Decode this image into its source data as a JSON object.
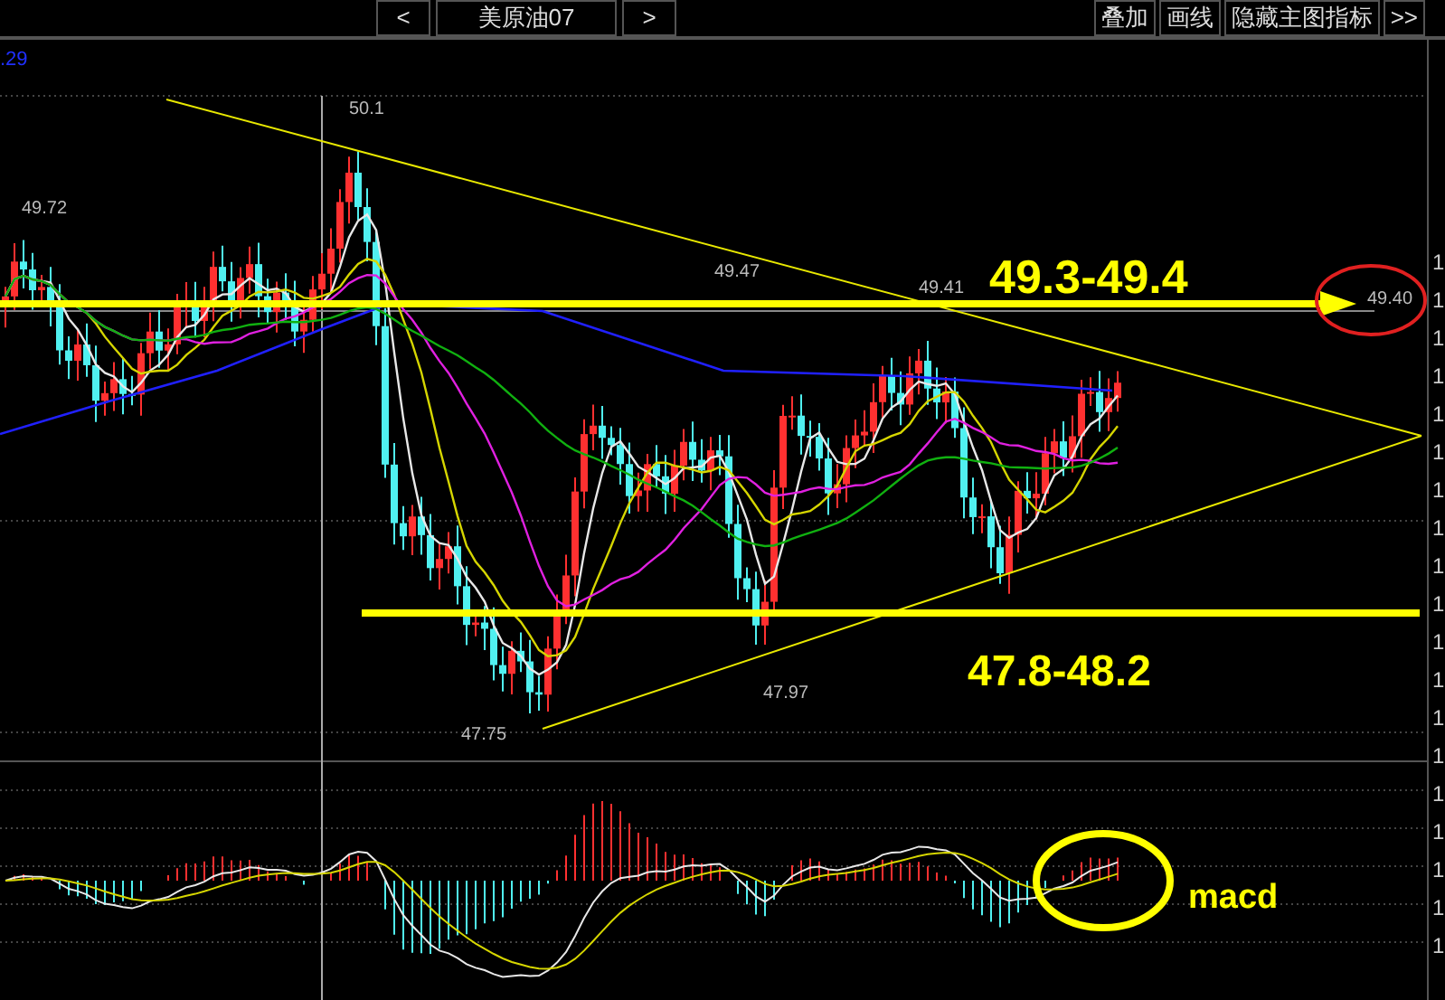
{
  "toolbar": {
    "prev_button": "<",
    "symbol": "美原油07",
    "next_button": ">",
    "buttons": [
      "叠加",
      "画线",
      "隐藏主图指标",
      ">>"
    ]
  },
  "chart": {
    "corner_value": ".29",
    "price_labels": [
      "50.1",
      "49.72",
      "49.47",
      "49.41",
      "47.97",
      "47.75"
    ],
    "current_price": "49.40",
    "annotations": [
      "49.3-49.4",
      "47.8-48.2"
    ]
  },
  "macd_panel": {
    "label": "macd"
  },
  "right_axis_labels": [
    "1",
    "1",
    "1",
    "1",
    "1",
    "1",
    "1",
    "1",
    "1",
    "1",
    "1",
    "1",
    "1",
    "1",
    "1",
    "1",
    "1",
    "1",
    "1"
  ]
}
